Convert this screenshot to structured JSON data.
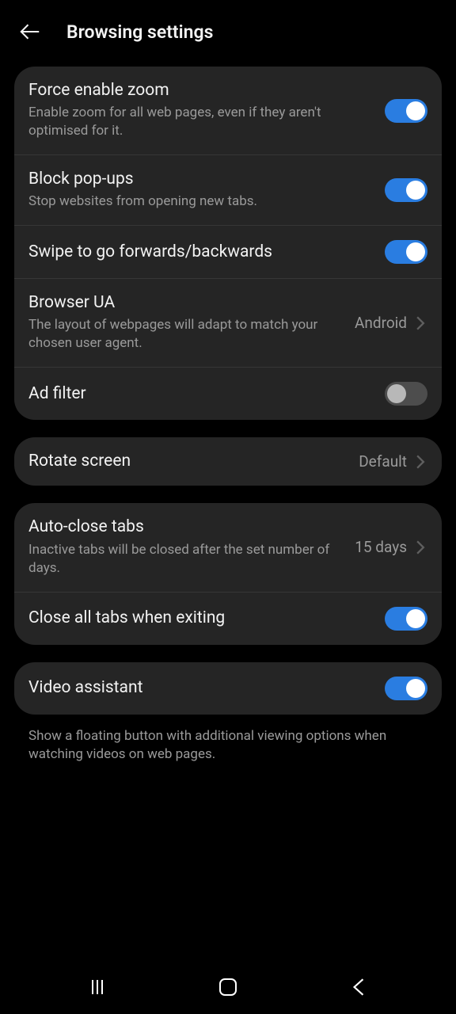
{
  "header": {
    "title": "Browsing settings"
  },
  "group1": {
    "forceZoom": {
      "title": "Force enable zoom",
      "sub": "Enable zoom for all web pages, even if they aren't optimised for it.",
      "on": true
    },
    "blockPopups": {
      "title": "Block pop-ups",
      "sub": "Stop websites from opening new tabs.",
      "on": true
    },
    "swipeNav": {
      "title": "Swipe to go forwards/backwards",
      "on": true
    },
    "browserUA": {
      "title": "Browser UA",
      "sub": "The layout of webpages will adapt to match your chosen user agent.",
      "value": "Android"
    },
    "adFilter": {
      "title": "Ad filter",
      "on": false
    }
  },
  "group2": {
    "rotateScreen": {
      "title": "Rotate screen",
      "value": "Default"
    }
  },
  "group3": {
    "autoClose": {
      "title": "Auto-close tabs",
      "sub": "Inactive tabs will be closed after the set number of days.",
      "value": "15 days"
    },
    "closeOnExit": {
      "title": "Close all tabs when exiting",
      "on": true
    }
  },
  "group4": {
    "videoAssistant": {
      "title": "Video assistant",
      "on": true
    },
    "footnote": "Show a floating button with additional viewing options when watching videos on web pages."
  }
}
